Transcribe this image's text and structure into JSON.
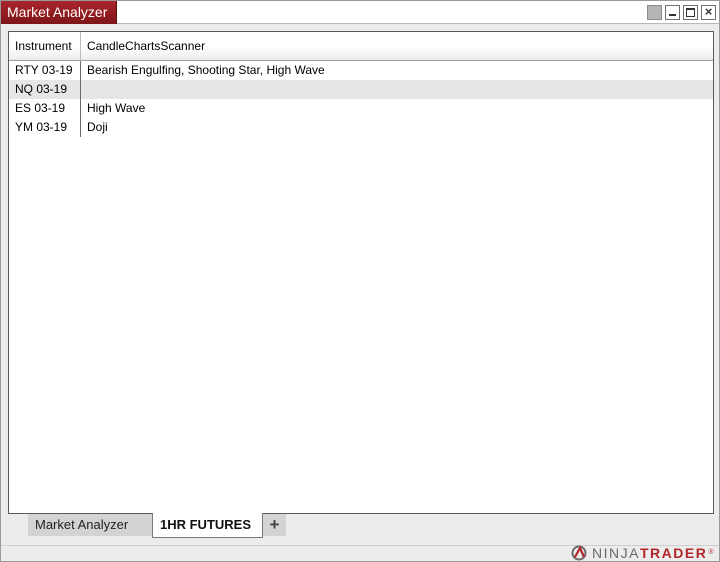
{
  "window": {
    "title": "Market Analyzer",
    "accent_color": "#a8262b",
    "controls": [
      "gray-square-icon",
      "minimize-icon",
      "maximize-icon",
      "close-icon"
    ]
  },
  "grid": {
    "columns": [
      "Instrument",
      "CandleChartsScanner"
    ],
    "rows": [
      {
        "instrument": "RTY 03-19",
        "scanner": "Bearish Engulfing, Shooting Star, High Wave"
      },
      {
        "instrument": "NQ 03-19",
        "scanner": ""
      },
      {
        "instrument": "ES 03-19",
        "scanner": "High Wave"
      },
      {
        "instrument": "YM 03-19",
        "scanner": "Doji"
      }
    ]
  },
  "tabs": [
    {
      "label": "Market Analyzer",
      "active": false
    },
    {
      "label": "1HR FUTURES",
      "active": true
    }
  ],
  "add_tab_label": "+",
  "branding": {
    "ninja": "NINJA",
    "trader": "TRADER",
    "reg": "®"
  }
}
